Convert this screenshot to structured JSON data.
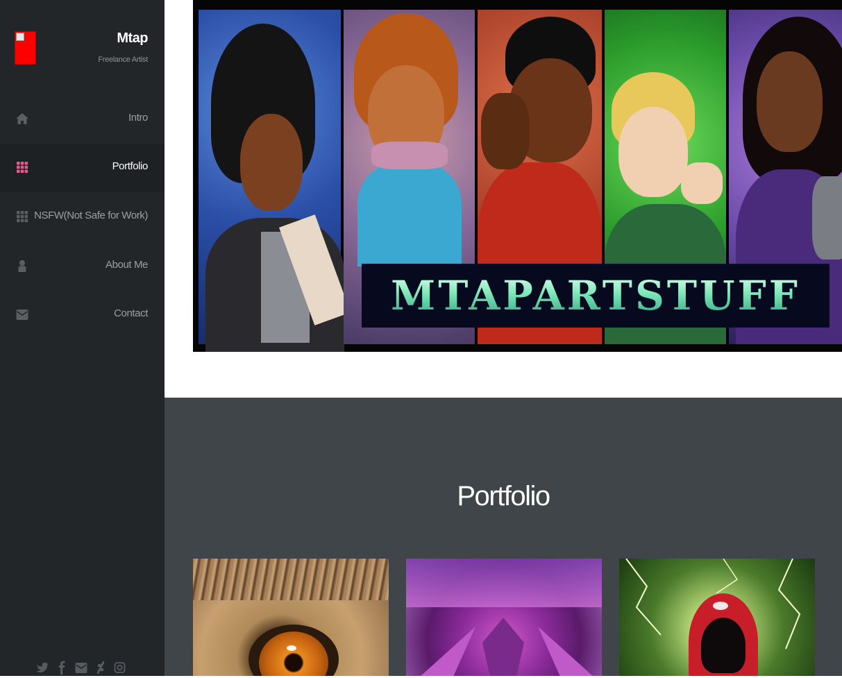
{
  "sidebar": {
    "site_name": "Mtap",
    "site_tagline": "Freelance Artist",
    "nav": [
      {
        "label": "Intro",
        "icon": "home-icon",
        "active": false
      },
      {
        "label": "Portfolio",
        "icon": "grid-icon",
        "active": true
      },
      {
        "label": "NSFW(Not Safe for Work)",
        "icon": "grid-icon",
        "active": false
      },
      {
        "label": "About Me",
        "icon": "user-icon",
        "active": false
      },
      {
        "label": "Contact",
        "icon": "envelope-icon",
        "active": false
      }
    ],
    "social_icons": [
      "twitter-icon",
      "facebook-icon",
      "email-icon",
      "deviantart-icon",
      "instagram-icon"
    ]
  },
  "hero": {
    "banner_title": "MTAPARTSTUFF"
  },
  "portfolio": {
    "heading": "Portfolio",
    "thumbnails": [
      "eye-artwork",
      "purple-creature-artwork",
      "red-hood-lightning-artwork"
    ]
  },
  "colors": {
    "sidebar_bg": "#222629",
    "accent": "#e85a8a",
    "portfolio_bg": "#3f4549"
  }
}
